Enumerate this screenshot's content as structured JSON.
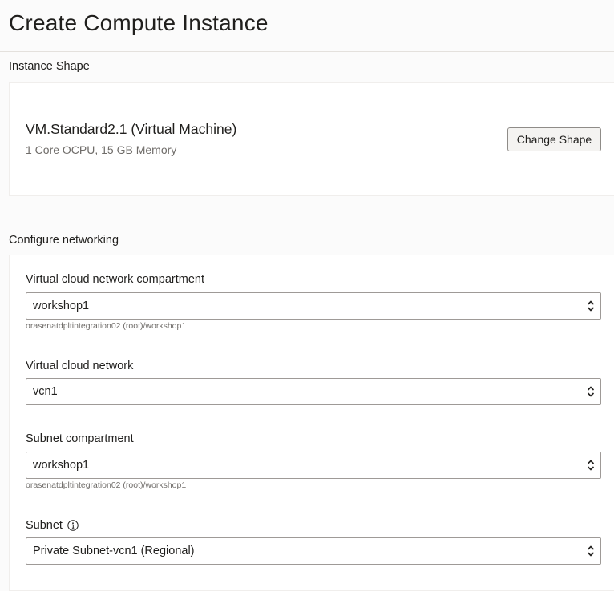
{
  "page": {
    "title": "Create Compute Instance"
  },
  "instance_shape": {
    "heading": "Instance Shape",
    "shape_name": "VM.Standard2.1 (Virtual Machine)",
    "shape_details": "1 Core OCPU, 15 GB Memory",
    "change_button_label": "Change Shape"
  },
  "networking": {
    "heading": "Configure networking",
    "fields": [
      {
        "label": "Virtual cloud network compartment",
        "value": "workshop1",
        "hint": "orasenatdpltintegration02 (root)/workshop1"
      },
      {
        "label": "Virtual cloud network",
        "value": "vcn1"
      },
      {
        "label": "Subnet compartment",
        "value": "workshop1",
        "hint": "orasenatdpltintegration02 (root)/workshop1"
      },
      {
        "label": "Subnet",
        "value": "Private Subnet-vcn1 (Regional)",
        "icon": "info-icon"
      }
    ]
  },
  "icons": {
    "select_arrows": "select-arrows-icon",
    "info": "info-icon"
  }
}
